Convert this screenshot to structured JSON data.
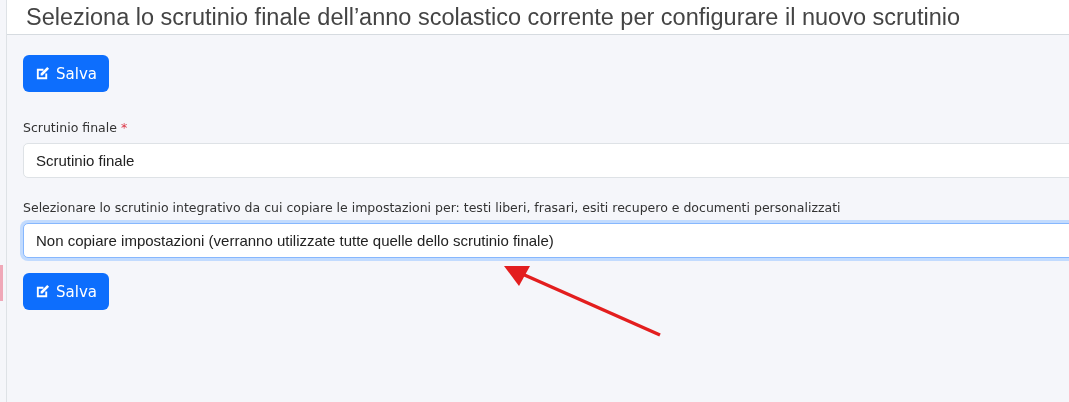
{
  "page_title": "Seleziona lo scrutinio finale dell’anno scolastico corrente per configurare il nuovo scrutinio",
  "top_button": {
    "label": "Salva"
  },
  "fields": [
    {
      "label": "Scrutinio finale",
      "required_mark": "*",
      "value": "Scrutinio finale",
      "focused": false
    },
    {
      "label": "Selezionare lo scrutinio integrativo da cui copiare le impostazioni per: testi liberi, frasari, esiti recupero e documenti personalizzati",
      "value": "Non copiare impostazioni (verranno utilizzate tutte quelle dello scrutinio finale)",
      "focused": true
    }
  ],
  "bottom_button": {
    "label": "Salva"
  }
}
